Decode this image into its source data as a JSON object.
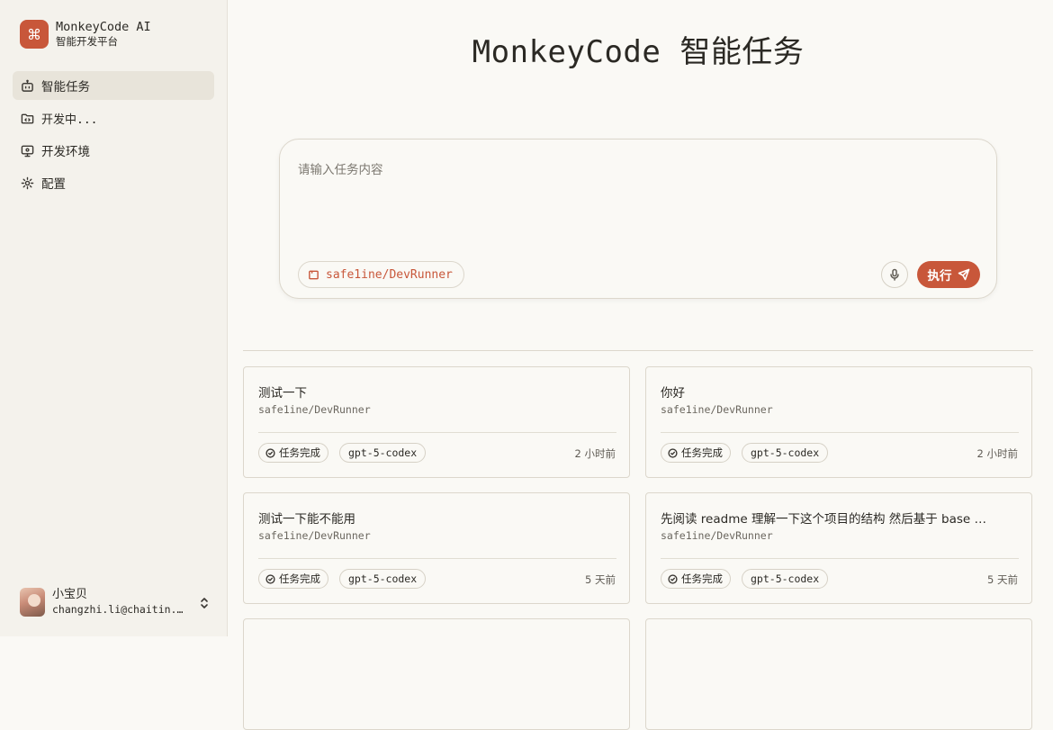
{
  "brand": {
    "name": "MonkeyCode AI",
    "subtitle": "智能开发平台",
    "logo_glyph": "⌘",
    "accent_color": "#c8573a"
  },
  "nav": {
    "items": [
      {
        "label": "智能任务",
        "icon": "bot-icon",
        "active": true
      },
      {
        "label": "开发中...",
        "icon": "folder-code-icon",
        "active": false
      },
      {
        "label": "开发环境",
        "icon": "monitor-icon",
        "active": false
      },
      {
        "label": "配置",
        "icon": "gear-icon",
        "active": false
      }
    ]
  },
  "user": {
    "name": "小宝贝",
    "email": "changzhi.li@chaitin.com"
  },
  "main": {
    "title": "MonkeyCode 智能任务",
    "composer": {
      "placeholder": "请输入任务内容",
      "repo": "safe1ine/DevRunner",
      "run_label": "执行"
    }
  },
  "tasks": [
    {
      "title": "测试一下",
      "repo": "safe1ine/DevRunner",
      "status": "任务完成",
      "model": "gpt-5-codex",
      "time": "2 小时前"
    },
    {
      "title": "你好",
      "repo": "safe1ine/DevRunner",
      "status": "任务完成",
      "model": "gpt-5-codex",
      "time": "2 小时前"
    },
    {
      "title": "测试一下能不能用",
      "repo": "safe1ine/DevRunner",
      "status": "任务完成",
      "model": "gpt-5-codex",
      "time": "5 天前"
    },
    {
      "title": "先阅读 readme 理解一下这个项目的结构 然后基于 base …",
      "repo": "safe1ine/DevRunner",
      "status": "任务完成",
      "model": "gpt-5-codex",
      "time": "5 天前"
    }
  ]
}
